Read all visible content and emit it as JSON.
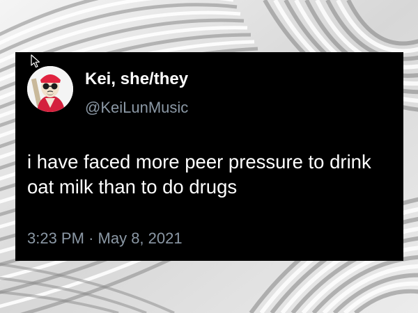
{
  "background": {
    "icon": "architectural-white-ribs-background",
    "colors": [
      "#f2f2f2",
      "#bdbdbd",
      "#7a7a7a"
    ]
  },
  "tweet": {
    "display_name": "Kei, she/they",
    "handle": "@KeiLunMusic",
    "text": "i have faced more peer pressure to drink oat milk than to do drugs",
    "time": "3:23 PM",
    "separator": "·",
    "date": "May 8, 2021",
    "avatar_icon": "illustrated-person-avatar",
    "colors": {
      "card": "#000000",
      "name": "#ffffff",
      "secondary": "#8b98a5"
    }
  },
  "cursor_icon": "mouse-pointer-icon"
}
